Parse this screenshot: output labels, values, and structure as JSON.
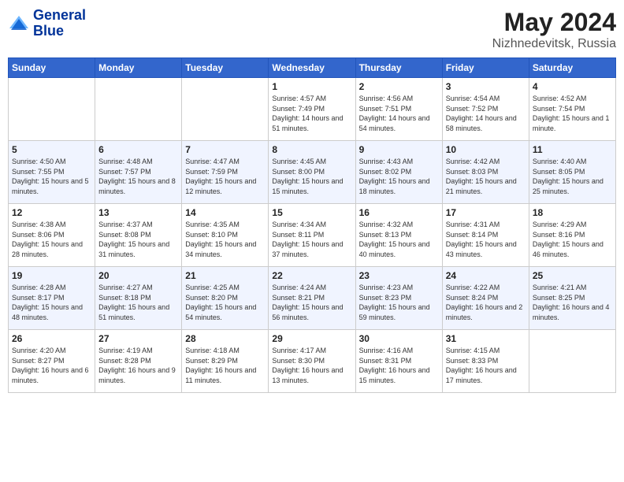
{
  "logo": {
    "line1": "General",
    "line2": "Blue"
  },
  "title": {
    "month_year": "May 2024",
    "location": "Nizhnedevitsk, Russia"
  },
  "days_of_week": [
    "Sunday",
    "Monday",
    "Tuesday",
    "Wednesday",
    "Thursday",
    "Friday",
    "Saturday"
  ],
  "weeks": [
    [
      {
        "num": "",
        "info": ""
      },
      {
        "num": "",
        "info": ""
      },
      {
        "num": "",
        "info": ""
      },
      {
        "num": "1",
        "info": "Sunrise: 4:57 AM\nSunset: 7:49 PM\nDaylight: 14 hours\nand 51 minutes."
      },
      {
        "num": "2",
        "info": "Sunrise: 4:56 AM\nSunset: 7:51 PM\nDaylight: 14 hours\nand 54 minutes."
      },
      {
        "num": "3",
        "info": "Sunrise: 4:54 AM\nSunset: 7:52 PM\nDaylight: 14 hours\nand 58 minutes."
      },
      {
        "num": "4",
        "info": "Sunrise: 4:52 AM\nSunset: 7:54 PM\nDaylight: 15 hours\nand 1 minute."
      }
    ],
    [
      {
        "num": "5",
        "info": "Sunrise: 4:50 AM\nSunset: 7:55 PM\nDaylight: 15 hours\nand 5 minutes."
      },
      {
        "num": "6",
        "info": "Sunrise: 4:48 AM\nSunset: 7:57 PM\nDaylight: 15 hours\nand 8 minutes."
      },
      {
        "num": "7",
        "info": "Sunrise: 4:47 AM\nSunset: 7:59 PM\nDaylight: 15 hours\nand 12 minutes."
      },
      {
        "num": "8",
        "info": "Sunrise: 4:45 AM\nSunset: 8:00 PM\nDaylight: 15 hours\nand 15 minutes."
      },
      {
        "num": "9",
        "info": "Sunrise: 4:43 AM\nSunset: 8:02 PM\nDaylight: 15 hours\nand 18 minutes."
      },
      {
        "num": "10",
        "info": "Sunrise: 4:42 AM\nSunset: 8:03 PM\nDaylight: 15 hours\nand 21 minutes."
      },
      {
        "num": "11",
        "info": "Sunrise: 4:40 AM\nSunset: 8:05 PM\nDaylight: 15 hours\nand 25 minutes."
      }
    ],
    [
      {
        "num": "12",
        "info": "Sunrise: 4:38 AM\nSunset: 8:06 PM\nDaylight: 15 hours\nand 28 minutes."
      },
      {
        "num": "13",
        "info": "Sunrise: 4:37 AM\nSunset: 8:08 PM\nDaylight: 15 hours\nand 31 minutes."
      },
      {
        "num": "14",
        "info": "Sunrise: 4:35 AM\nSunset: 8:10 PM\nDaylight: 15 hours\nand 34 minutes."
      },
      {
        "num": "15",
        "info": "Sunrise: 4:34 AM\nSunset: 8:11 PM\nDaylight: 15 hours\nand 37 minutes."
      },
      {
        "num": "16",
        "info": "Sunrise: 4:32 AM\nSunset: 8:13 PM\nDaylight: 15 hours\nand 40 minutes."
      },
      {
        "num": "17",
        "info": "Sunrise: 4:31 AM\nSunset: 8:14 PM\nDaylight: 15 hours\nand 43 minutes."
      },
      {
        "num": "18",
        "info": "Sunrise: 4:29 AM\nSunset: 8:16 PM\nDaylight: 15 hours\nand 46 minutes."
      }
    ],
    [
      {
        "num": "19",
        "info": "Sunrise: 4:28 AM\nSunset: 8:17 PM\nDaylight: 15 hours\nand 48 minutes."
      },
      {
        "num": "20",
        "info": "Sunrise: 4:27 AM\nSunset: 8:18 PM\nDaylight: 15 hours\nand 51 minutes."
      },
      {
        "num": "21",
        "info": "Sunrise: 4:25 AM\nSunset: 8:20 PM\nDaylight: 15 hours\nand 54 minutes."
      },
      {
        "num": "22",
        "info": "Sunrise: 4:24 AM\nSunset: 8:21 PM\nDaylight: 15 hours\nand 56 minutes."
      },
      {
        "num": "23",
        "info": "Sunrise: 4:23 AM\nSunset: 8:23 PM\nDaylight: 15 hours\nand 59 minutes."
      },
      {
        "num": "24",
        "info": "Sunrise: 4:22 AM\nSunset: 8:24 PM\nDaylight: 16 hours\nand 2 minutes."
      },
      {
        "num": "25",
        "info": "Sunrise: 4:21 AM\nSunset: 8:25 PM\nDaylight: 16 hours\nand 4 minutes."
      }
    ],
    [
      {
        "num": "26",
        "info": "Sunrise: 4:20 AM\nSunset: 8:27 PM\nDaylight: 16 hours\nand 6 minutes."
      },
      {
        "num": "27",
        "info": "Sunrise: 4:19 AM\nSunset: 8:28 PM\nDaylight: 16 hours\nand 9 minutes."
      },
      {
        "num": "28",
        "info": "Sunrise: 4:18 AM\nSunset: 8:29 PM\nDaylight: 16 hours\nand 11 minutes."
      },
      {
        "num": "29",
        "info": "Sunrise: 4:17 AM\nSunset: 8:30 PM\nDaylight: 16 hours\nand 13 minutes."
      },
      {
        "num": "30",
        "info": "Sunrise: 4:16 AM\nSunset: 8:31 PM\nDaylight: 16 hours\nand 15 minutes."
      },
      {
        "num": "31",
        "info": "Sunrise: 4:15 AM\nSunset: 8:33 PM\nDaylight: 16 hours\nand 17 minutes."
      },
      {
        "num": "",
        "info": ""
      }
    ]
  ]
}
